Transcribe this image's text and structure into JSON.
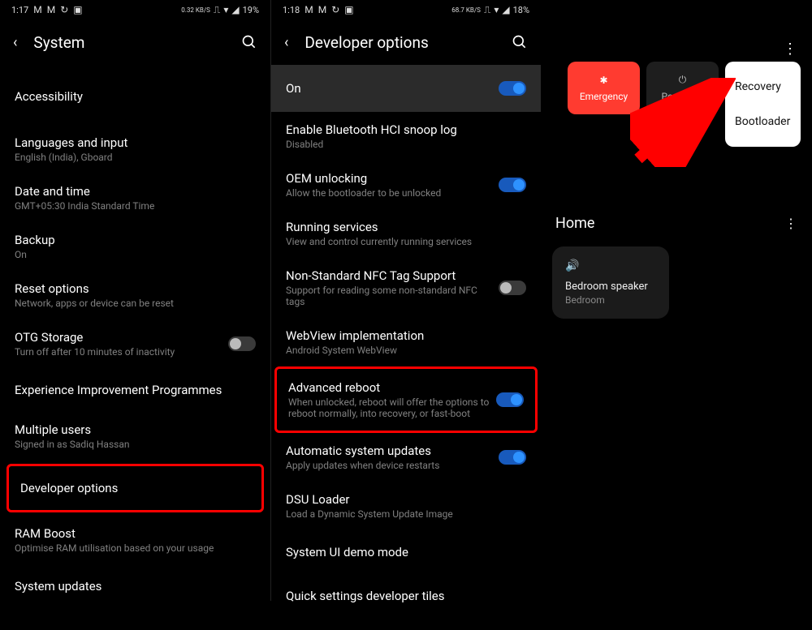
{
  "panel1": {
    "status": {
      "time": "1:17",
      "net": "0.32 KB/S",
      "batt": "19%"
    },
    "header_title": "System",
    "items": [
      {
        "title": "Accessibility",
        "sub": ""
      },
      {
        "title": "Languages and input",
        "sub": "English (India), Gboard"
      },
      {
        "title": "Date and time",
        "sub": "GMT+05:30 India Standard Time"
      },
      {
        "title": "Backup",
        "sub": "On"
      },
      {
        "title": "Reset options",
        "sub": "Network, apps or device can be reset"
      },
      {
        "title": "OTG Storage",
        "sub": "Turn off after 10 minutes of inactivity",
        "switch": "off"
      },
      {
        "title": "Experience Improvement Programmes",
        "sub": ""
      },
      {
        "title": "Multiple users",
        "sub": "Signed in as Sadiq Hassan"
      },
      {
        "title": "Developer options",
        "sub": "",
        "highlight": true
      },
      {
        "title": "RAM Boost",
        "sub": "Optimise RAM utilisation based on your usage"
      },
      {
        "title": "System updates",
        "sub": ""
      }
    ]
  },
  "panel2": {
    "status": {
      "time": "1:18",
      "net": "68.7 KB/S",
      "batt": "18%"
    },
    "header_title": "Developer options",
    "on_row": "On",
    "items": [
      {
        "title": "Enable Bluetooth HCI snoop log",
        "sub": "Disabled"
      },
      {
        "title": "OEM unlocking",
        "sub": "Allow the bootloader to be unlocked",
        "switch": "on"
      },
      {
        "title": "Running services",
        "sub": "View and control currently running services"
      },
      {
        "title": "Non-Standard NFC Tag Support",
        "sub": "Support for reading some non-standard NFC tags",
        "switch": "off"
      },
      {
        "title": "WebView implementation",
        "sub": "Android System WebView"
      },
      {
        "title": "Advanced reboot",
        "sub": "When unlocked, reboot will offer the options to reboot normally, into recovery, or fast-boot",
        "switch": "on",
        "highlight": true
      },
      {
        "title": "Automatic system updates",
        "sub": "Apply updates when device restarts",
        "switch": "on"
      },
      {
        "title": "DSU Loader",
        "sub": "Load a Dynamic System Update Image"
      },
      {
        "title": "System UI demo mode",
        "sub": ""
      },
      {
        "title": "Quick settings developer tiles",
        "sub": ""
      }
    ]
  },
  "panel3": {
    "emergency": "Emergency",
    "poweroff": "Power off",
    "menu": {
      "recovery": "Recovery",
      "bootloader": "Bootloader"
    },
    "home_title": "Home",
    "device": {
      "name": "Bedroom speaker",
      "location": "Bedroom"
    }
  }
}
